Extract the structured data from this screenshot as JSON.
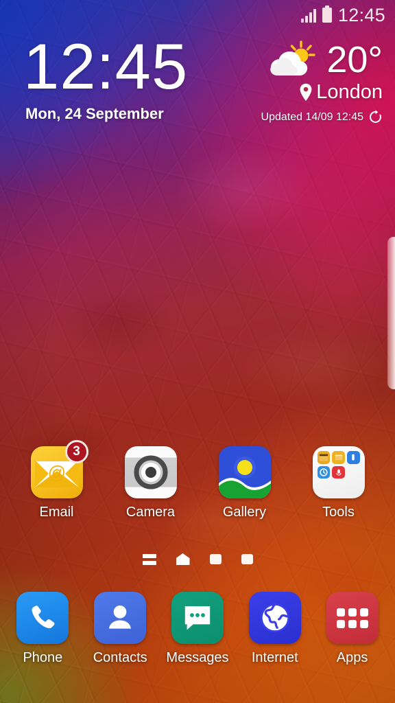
{
  "status_bar": {
    "clock": "12:45",
    "icons": [
      "signal-bars-icon",
      "battery-icon"
    ],
    "text_color": "#fbe9ee"
  },
  "clock_widget": {
    "time": "12:45",
    "date": "Mon, 24 September"
  },
  "weather_widget": {
    "icon": "sun-behind-cloud-icon",
    "temperature": "20°",
    "location": "London",
    "location_icon": "map-pin-icon",
    "updated": "Updated 14/09 12:45",
    "refresh_icon": "refresh-icon"
  },
  "home_apps": [
    {
      "label": "Email",
      "icon": "email-envelope-icon",
      "badge": "3"
    },
    {
      "label": "Camera",
      "icon": "camera-lens-icon",
      "badge": ""
    },
    {
      "label": "Gallery",
      "icon": "gallery-landscape-icon",
      "badge": ""
    },
    {
      "label": "Tools",
      "icon": "tools-folder-icon",
      "badge": ""
    }
  ],
  "page_indicators": [
    {
      "name": "briefing-page-indicator",
      "shape": "list",
      "active": false
    },
    {
      "name": "home-page-indicator",
      "shape": "home",
      "active": true
    },
    {
      "name": "page-indicator-3",
      "shape": "square",
      "active": false
    },
    {
      "name": "page-indicator-4",
      "shape": "square",
      "active": false
    }
  ],
  "dock_apps": [
    {
      "label": "Phone",
      "icon": "phone-handset-icon",
      "color": "#1f8ef0"
    },
    {
      "label": "Contacts",
      "icon": "person-icon",
      "color": "#4570e0"
    },
    {
      "label": "Messages",
      "icon": "speech-bubble-icon",
      "color": "#119579"
    },
    {
      "label": "Internet",
      "icon": "globe-icon",
      "color": "#3034dc"
    },
    {
      "label": "Apps",
      "icon": "apps-grid-icon",
      "color": "#cc3640"
    }
  ],
  "tools_folder_items": [
    {
      "name": "calendar-mini-icon",
      "color": "#e9a81d"
    },
    {
      "name": "notes-mini-icon",
      "color": "#edb21f"
    },
    {
      "name": "flashlight-mini-icon",
      "color": "#2f7fe0"
    },
    {
      "name": "clock-mini-icon",
      "color": "#2f8fe5"
    },
    {
      "name": "voice-recorder-mini-icon",
      "color": "#e0343a"
    }
  ],
  "edge_handle": {
    "name": "edge-panel-handle"
  }
}
